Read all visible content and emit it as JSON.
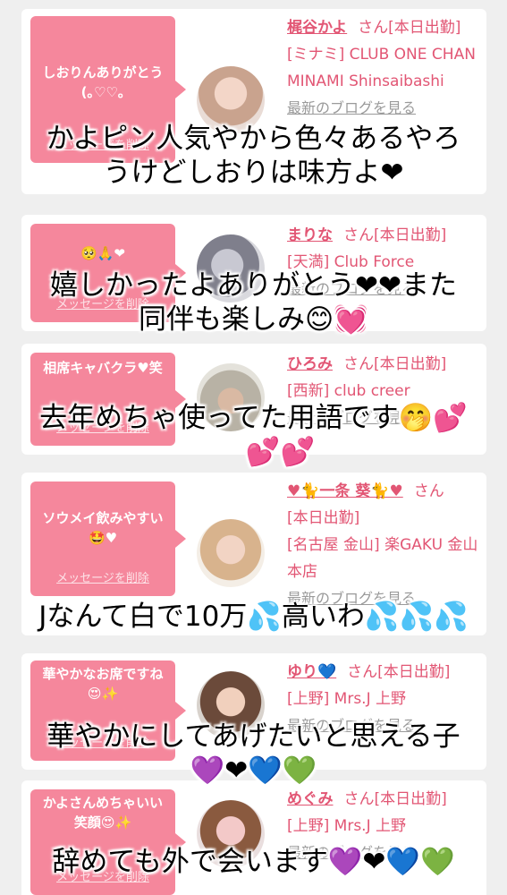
{
  "colors": {
    "accent": "#f5879c",
    "link": "#e25674",
    "muted": "#9a9a9a",
    "background": "#efefef"
  },
  "cards": [
    {
      "message": "しおりんありがとう(｡♡♡｡",
      "delete_label": "メッセージを削除",
      "name": "梶谷かよ",
      "san": "さん",
      "status": "[本日出勤]",
      "shop": "[ミナミ] CLUB ONE CHAN MINAMI Shinsaibashi",
      "blog": "最新のブログを見る"
    },
    {
      "message": "🥺🙏❤",
      "delete_label": "メッセージを削除",
      "name": "まりな",
      "san": "さん",
      "status": "[本日出勤]",
      "shop": "[天満] Club Force",
      "blog": "最新のブログを見る"
    },
    {
      "message": "相席キャバクラ♥笑",
      "delete_label": "メッセージを削除",
      "name": "ひろみ",
      "san": "さん",
      "status": "[本日出勤]",
      "shop": "[西新] club creer",
      "blog": "最新のブログを見る"
    },
    {
      "message": "ソウメイ飲みやすい🤩♥",
      "delete_label": "メッセージを削除",
      "name": "♥🐈一条 葵🐈♥",
      "san": "さん",
      "status": "[本日出勤]",
      "shop": "[名古屋 金山] 楽GAKU 金山本店",
      "blog": "最新のブログを見る"
    },
    {
      "message": "華やかなお席ですね😍✨",
      "delete_label": "メッセージを削除",
      "name": "ゆり💙",
      "san": "さん",
      "status": "[本日出勤]",
      "shop": "[上野] Mrs.J 上野",
      "blog": "最新のブログを見る"
    },
    {
      "message": "かよさんめちゃいい笑顔😍✨",
      "delete_label": "メッセージを削除",
      "name": "めぐみ",
      "san": "さん",
      "status": "[本日出勤]",
      "shop": "[上野] Mrs.J 上野",
      "blog": "最新のブログを見る"
    }
  ],
  "captions": [
    {
      "line1": "かよピン人気やから色々あるやろ",
      "line2": "うけどしおりは味方よ❤"
    },
    {
      "line1": "嬉しかったよありがとう❤❤また",
      "line2": "同伴も楽しみ😊💓"
    },
    {
      "line1": "去年めちゃ使ってた用語です🤭💕",
      "line2": "💕💕"
    },
    {
      "line1": "Jなんて白で10万💦高いわ💦💦💦",
      "line2": ""
    },
    {
      "line1": "華やかにしてあげたいと思える子",
      "line2": "💜❤💙💚"
    },
    {
      "line1": "辞めても外で会います💜❤💙💚",
      "line2": ""
    }
  ]
}
